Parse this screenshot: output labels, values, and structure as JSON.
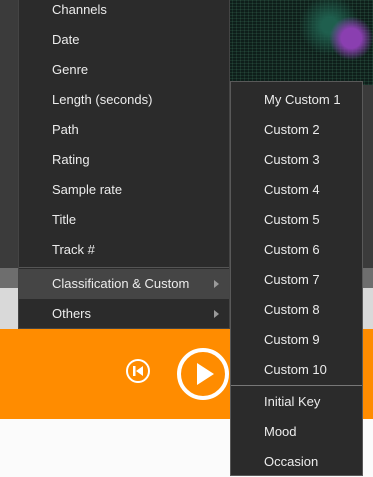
{
  "menu": {
    "items": [
      {
        "label": "Channels"
      },
      {
        "label": "Date"
      },
      {
        "label": "Genre"
      },
      {
        "label": "Length (seconds)"
      },
      {
        "label": "Path"
      },
      {
        "label": "Rating"
      },
      {
        "label": "Sample rate"
      },
      {
        "label": "Title"
      },
      {
        "label": "Track #"
      }
    ],
    "classification": {
      "label": "Classification & Custom",
      "has_submenu": true,
      "highlighted": true
    },
    "others": {
      "label": "Others",
      "has_submenu": true
    }
  },
  "submenu": {
    "custom_items": [
      {
        "label": "My Custom 1"
      },
      {
        "label": "Custom 2"
      },
      {
        "label": "Custom 3"
      },
      {
        "label": "Custom 4"
      },
      {
        "label": "Custom 5"
      },
      {
        "label": "Custom 6"
      },
      {
        "label": "Custom 7"
      },
      {
        "label": "Custom 8"
      },
      {
        "label": "Custom 9"
      },
      {
        "label": "Custom 10"
      }
    ],
    "other_items": [
      {
        "label": "Initial Key"
      },
      {
        "label": "Mood"
      },
      {
        "label": "Occasion"
      }
    ]
  },
  "player": {
    "prev_icon": "skip-previous-icon",
    "play_icon": "play-icon",
    "accent_color": "#ff8c00"
  }
}
